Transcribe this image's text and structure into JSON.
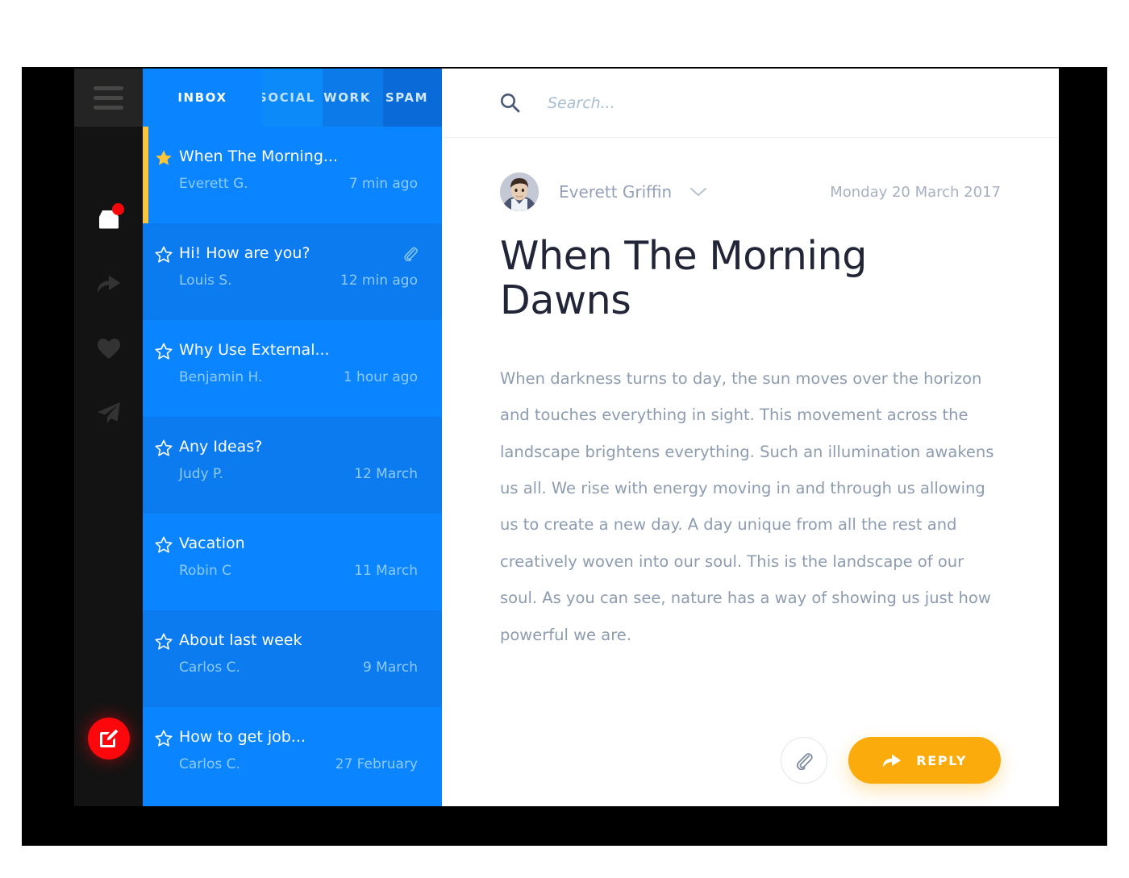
{
  "rail": {
    "menu_icon": "hamburger-icon",
    "items": [
      {
        "icon": "inbox-icon",
        "badge": true,
        "active": true
      },
      {
        "icon": "forward-arrow-icon",
        "badge": false,
        "active": false
      },
      {
        "icon": "heart-icon",
        "badge": false,
        "active": false
      },
      {
        "icon": "send-icon",
        "badge": false,
        "active": false
      }
    ],
    "compose": {
      "icon": "compose-pencil-icon",
      "color": "#fb070c"
    }
  },
  "tabs": [
    {
      "label": "INBOX",
      "active": true
    },
    {
      "label": "SOCIAL",
      "active": false
    },
    {
      "label": "WORK",
      "active": false
    },
    {
      "label": "SPAM",
      "active": false
    }
  ],
  "emails": [
    {
      "subject": "When The Morning...",
      "sender": "Everett G.",
      "time": "7 min ago",
      "starred": true,
      "attachment": false,
      "selected": true
    },
    {
      "subject": "Hi! How are you?",
      "sender": "Louis S.",
      "time": "12 min ago",
      "starred": false,
      "attachment": true,
      "selected": false
    },
    {
      "subject": "Why Use External...",
      "sender": "Benjamin H.",
      "time": "1 hour ago",
      "starred": false,
      "attachment": false,
      "selected": false
    },
    {
      "subject": "Any Ideas?",
      "sender": "Judy P.",
      "time": "12 March",
      "starred": false,
      "attachment": false,
      "selected": false
    },
    {
      "subject": "Vacation",
      "sender": "Robin C",
      "time": "11 March",
      "starred": false,
      "attachment": false,
      "selected": false
    },
    {
      "subject": "About last week",
      "sender": "Carlos C.",
      "time": "9 March",
      "starred": false,
      "attachment": false,
      "selected": false
    },
    {
      "subject": "How to get job...",
      "sender": "Carlos C.",
      "time": "27 February",
      "starred": false,
      "attachment": false,
      "selected": false
    }
  ],
  "search": {
    "placeholder": "Search...",
    "value": "",
    "icon": "search-icon"
  },
  "reader": {
    "sender_name": "Everett Griffin",
    "date": "Monday 20 March 2017",
    "title": "When The Morning Dawns",
    "body": "When darkness turns to day, the sun moves over the horizon and touches everything in sight. This movement across the landscape brightens everything. Such an illumination awakens us all. We rise with energy moving in and through us allowing us to create a new day. A day unique from all the rest and creatively woven into our soul. This is the landscape of our soul. As you can see, nature has a way of showing us just how powerful we are.",
    "attach_label": "attachment",
    "reply_label": "REPLY"
  },
  "colors": {
    "accent_blue": "#0a84ff",
    "accent_orange": "#fbab0b",
    "accent_red": "#fb070c",
    "star_gold": "#fcc638",
    "rail_dark": "#131313"
  }
}
